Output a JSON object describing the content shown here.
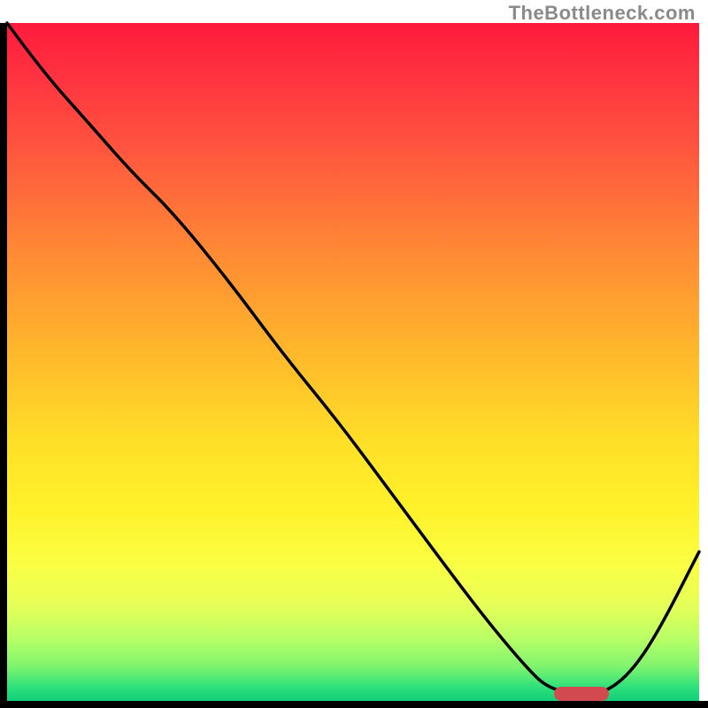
{
  "attribution": "TheBottleneck.com",
  "colors": {
    "attribution_text": "#8a8a8a",
    "curve": "#000000",
    "marker": "#d24a4f",
    "axis": "#000000"
  },
  "chart_data": {
    "type": "line",
    "title": "",
    "xlabel": "",
    "ylabel": "",
    "xlim": [
      0,
      100
    ],
    "ylim": [
      0,
      100
    ],
    "grid": false,
    "legend": false,
    "annotations": [
      "TheBottleneck.com"
    ],
    "background_gradient_stops": [
      {
        "pos": 0,
        "color": "#ff1a3c"
      },
      {
        "pos": 20,
        "color": "#ff5a3e"
      },
      {
        "pos": 48,
        "color": "#ffe028"
      },
      {
        "pos": 80,
        "color": "#faff44"
      },
      {
        "pos": 95,
        "color": "#7ef36e"
      },
      {
        "pos": 100,
        "color": "#12cf7a"
      }
    ],
    "series": [
      {
        "name": "bottleneck-curve",
        "x": [
          0,
          5,
          12,
          18,
          24,
          32,
          40,
          48,
          56,
          64,
          70,
          75,
          78,
          82,
          86,
          90,
          94,
          100
        ],
        "y": [
          100,
          93,
          85,
          78,
          72,
          62,
          51,
          41,
          30,
          19,
          11,
          5,
          2,
          1,
          1,
          4,
          10,
          22
        ]
      }
    ],
    "marker": {
      "name": "optimal-range",
      "x_start": 79,
      "x_end": 87,
      "y": 1
    }
  }
}
